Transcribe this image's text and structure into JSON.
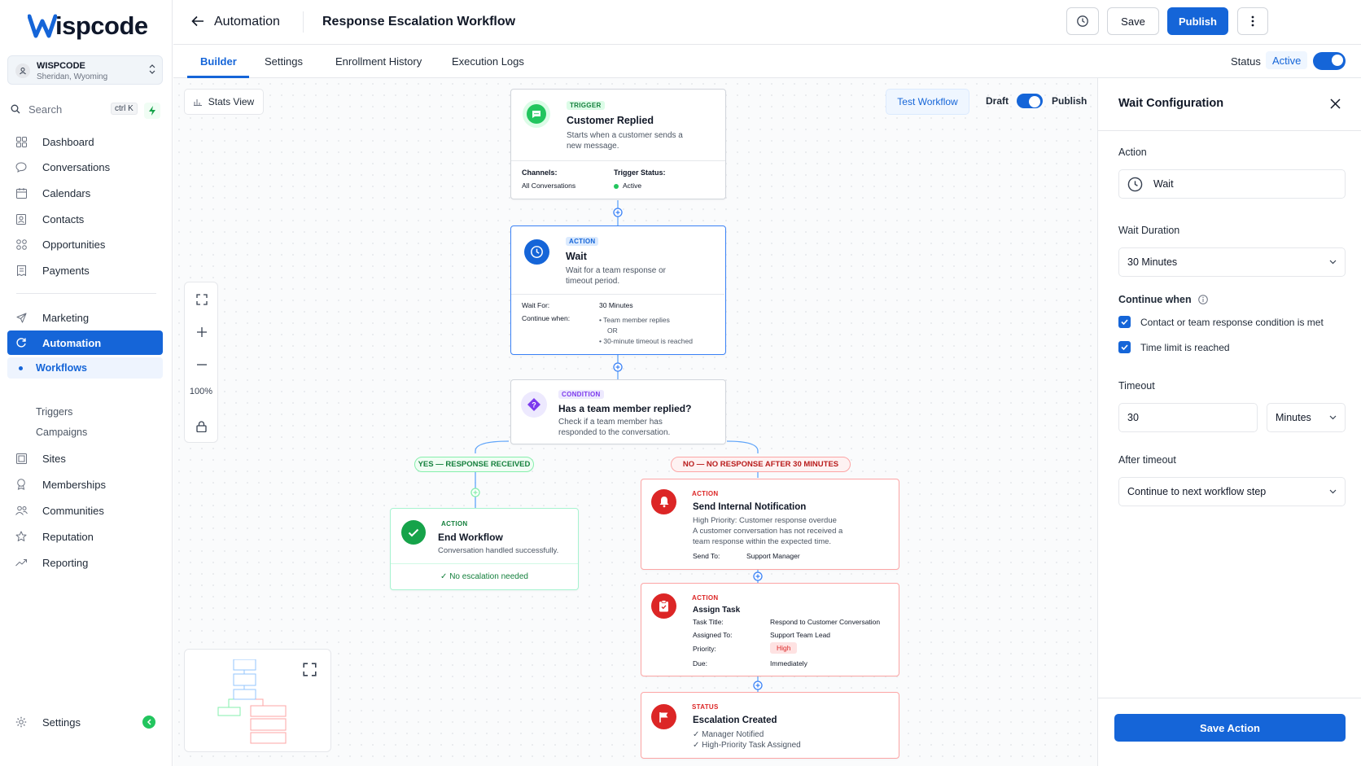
{
  "brand": {
    "logo_text": "Wispcode"
  },
  "location": {
    "name": "WISPCODE",
    "address": "Sheridan, Wyoming"
  },
  "search": {
    "label": "Search",
    "shortcut": "ctrl K"
  },
  "sidebar": {
    "items": [
      {
        "label": "Dashboard",
        "icon": "grid-icon"
      },
      {
        "label": "Conversations",
        "icon": "chat-bubble-icon"
      },
      {
        "label": "Calendars",
        "icon": "calendar-icon"
      },
      {
        "label": "Contacts",
        "icon": "contact-book-icon"
      },
      {
        "label": "Opportunities",
        "icon": "opportunities-icon"
      },
      {
        "label": "Payments",
        "icon": "receipt-icon"
      },
      {
        "label": "Marketing",
        "icon": "send-icon"
      },
      {
        "label": "Automation",
        "icon": "automation-icon"
      },
      {
        "label": "Sites",
        "icon": "sites-icon"
      },
      {
        "label": "Memberships",
        "icon": "badge-icon"
      },
      {
        "label": "Communities",
        "icon": "people-icon"
      },
      {
        "label": "Reputation",
        "icon": "star-icon"
      },
      {
        "label": "Reporting",
        "icon": "trend-icon"
      }
    ],
    "automation_sub": [
      "Workflows",
      "Triggers",
      "Campaigns"
    ],
    "settings_label": "Settings"
  },
  "header": {
    "section": "Automation",
    "title": "Response Escalation Workflow",
    "save_label": "Save",
    "publish_label": "Publish"
  },
  "tabs": [
    "Builder",
    "Settings",
    "Enrollment History",
    "Execution Logs"
  ],
  "status": {
    "label": "Status",
    "value": "Active"
  },
  "canvas": {
    "stats_view": "Stats View",
    "test_workflow": "Test Workflow",
    "draft_label": "Draft",
    "publish_label": "Publish",
    "zoom": "100%"
  },
  "nodes": {
    "trigger": {
      "tag": "TRIGGER",
      "title": "Customer Replied",
      "desc1": "Starts when a customer sends a",
      "desc2": "new message.",
      "channels_label": "Channels:",
      "channels_value": "All Conversations",
      "status_label": "Trigger Status:",
      "status_value": "Active"
    },
    "wait": {
      "tag": "ACTION",
      "title": "Wait",
      "desc1": "Wait for a team response or",
      "desc2": "timeout period.",
      "waitfor_label": "Wait For:",
      "waitfor_value": "30 Minutes",
      "continue_label": "Continue when:",
      "cond1": "• Team member replies",
      "or": "OR",
      "cond2": "• 30-minute timeout is reached"
    },
    "condition": {
      "tag": "CONDITION",
      "title": "Has a team member replied?",
      "desc1": "Check if a team member has",
      "desc2": "responded to the conversation."
    },
    "yes_branch": "YES — RESPONSE RECEIVED",
    "no_branch": "NO — NO RESPONSE AFTER 30 MINUTES",
    "end": {
      "tag": "ACTION",
      "title": "End Workflow",
      "desc": "Conversation handled successfully.",
      "footer": "✓ No escalation needed"
    },
    "notify": {
      "tag": "ACTION",
      "title": "Send Internal Notification",
      "line1": "High Priority: Customer response overdue",
      "line2": "A customer conversation has not received a",
      "line3": "team response within the expected time.",
      "sendto_label": "Send To:",
      "sendto_value": "Support Manager"
    },
    "task": {
      "tag": "ACTION",
      "title": "Assign Task",
      "rows": [
        {
          "label": "Task Title:",
          "value": "Respond to Customer Conversation"
        },
        {
          "label": "Assigned To:",
          "value": "Support Team Lead"
        },
        {
          "label": "Priority:",
          "value": "High"
        },
        {
          "label": "Due:",
          "value": "Immediately"
        }
      ]
    },
    "status": {
      "tag": "STATUS",
      "title": "Escalation Created",
      "line1": "✓ Manager Notified",
      "line2": "✓ High-Priority Task Assigned"
    }
  },
  "panel": {
    "title": "Wait Configuration",
    "action_label": "Action",
    "action_value": "Wait",
    "duration_label": "Wait Duration",
    "duration_value": "30 Minutes",
    "continue_label": "Continue when",
    "check1": "Contact or team response condition is met",
    "check2": "Time limit is reached",
    "timeout_label": "Timeout",
    "timeout_value": "30",
    "timeout_unit": "Minutes",
    "after_label": "After timeout",
    "after_value": "Continue to next workflow step",
    "save_label": "Save Action"
  },
  "colors": {
    "accent": "#1565d8",
    "success": "#16a34a",
    "danger": "#dc2626",
    "purple": "#7c3aed"
  }
}
